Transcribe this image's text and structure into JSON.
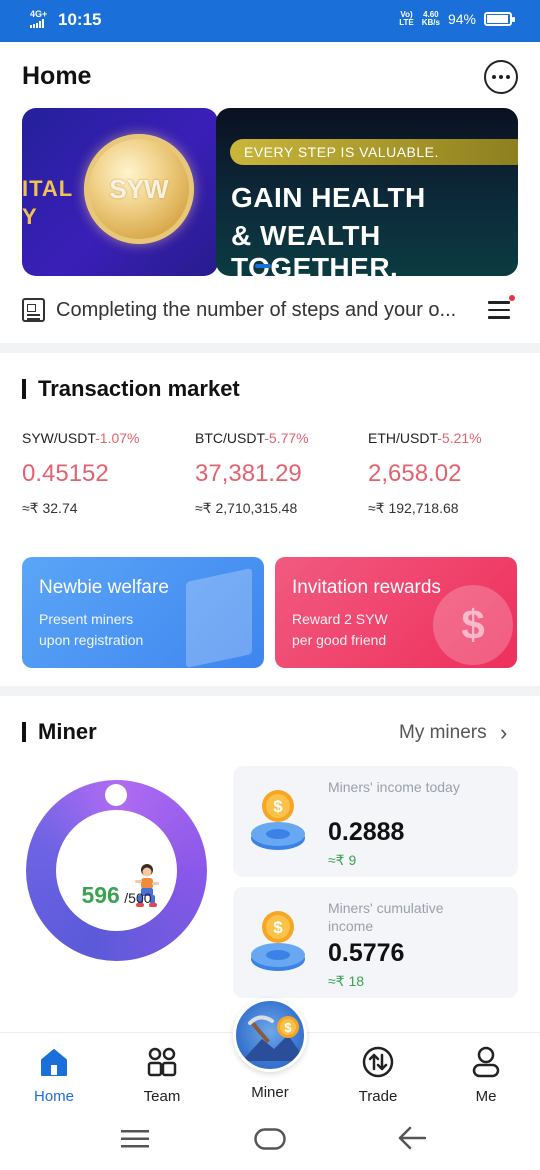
{
  "status_bar": {
    "network": "4G+",
    "time": "10:15",
    "volte": "Vo)\nLTE",
    "speed_value": "4.60",
    "speed_unit": "KB/s",
    "battery_text": "94%",
    "battery_level": 0.94
  },
  "header": {
    "title": "Home"
  },
  "banner": {
    "left_text_1": "ITAL",
    "left_text_2": "Y",
    "coin_text": "SYW",
    "tagline": "EVERY STEP IS VALUABLE.",
    "headline_1": "GAIN HEALTH",
    "headline_2": "& WEALTH TOGETHER.",
    "slide_count": 2,
    "active_slide": 1
  },
  "notice": {
    "text": "Completing the number of steps and your o..."
  },
  "market": {
    "title": "Transaction market",
    "items": [
      {
        "pair": "SYW/USDT",
        "change": "-1.07%",
        "price": "0.45152",
        "approx": "≈₹ 32.74"
      },
      {
        "pair": "BTC/USDT",
        "change": "-5.77%",
        "price": "37,381.29",
        "approx": "≈₹ 2,710,315.48"
      },
      {
        "pair": "ETH/USDT",
        "change": "-5.21%",
        "price": "2,658.02",
        "approx": "≈₹ 192,718.68"
      }
    ]
  },
  "promos": [
    {
      "title": "Newbie welfare",
      "line1": "Present miners",
      "line2": "upon registration"
    },
    {
      "title": "Invitation rewards",
      "line1": "Reward 2 SYW",
      "line2": "per good friend",
      "coin_glyph": "$"
    }
  ],
  "miner": {
    "title": "Miner",
    "link": "My miners",
    "steps_current": "596",
    "steps_total": "/500",
    "income_today_label": "Miners' income today",
    "income_today_value": "0.2888",
    "income_today_fiat": "≈₹ 9",
    "income_total_label": "Miners' cumulative income",
    "income_total_value": "0.5776",
    "income_total_fiat": "≈₹ 18",
    "coin_glyph": "$"
  },
  "tabs": [
    {
      "label": "Home",
      "icon": "home-icon",
      "active": true
    },
    {
      "label": "Team",
      "icon": "team-icon",
      "active": false
    },
    {
      "label": "Miner",
      "icon": "miner-icon",
      "active": false
    },
    {
      "label": "Trade",
      "icon": "trade-icon",
      "active": false
    },
    {
      "label": "Me",
      "icon": "profile-icon",
      "active": false
    }
  ],
  "colors": {
    "primary": "#1a6fd9",
    "negative": "#e4626f",
    "positive": "#3aa352"
  }
}
